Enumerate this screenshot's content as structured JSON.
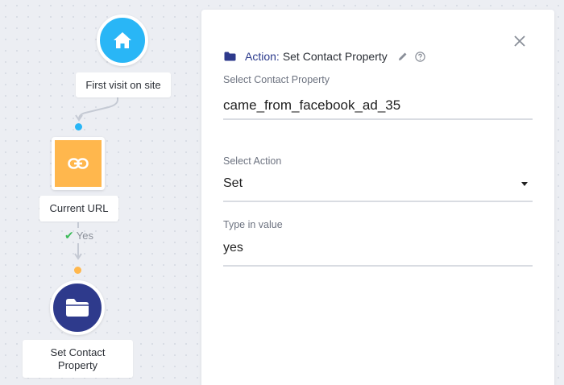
{
  "flow": {
    "nodes": [
      {
        "label": "First visit on site",
        "icon": "home-icon",
        "color": "#29b6f6"
      },
      {
        "label": "Current URL",
        "icon": "link-icon",
        "color": "#ffb74d"
      },
      {
        "label": "Set Contact Property",
        "icon": "folder-icon",
        "color": "#2e3a8c"
      }
    ],
    "edge_label": "Yes",
    "connector_colors": {
      "first": "#29b6f6",
      "second": "#ffb74d"
    }
  },
  "panel": {
    "action_prefix": "Action:",
    "title": "Set Contact Property",
    "fields": [
      {
        "label": "Select Contact Property",
        "value": "came_from_facebook_ad_35"
      },
      {
        "label": "Select Action",
        "value": "Set"
      },
      {
        "label": "Type in value",
        "value": "yes"
      }
    ]
  }
}
